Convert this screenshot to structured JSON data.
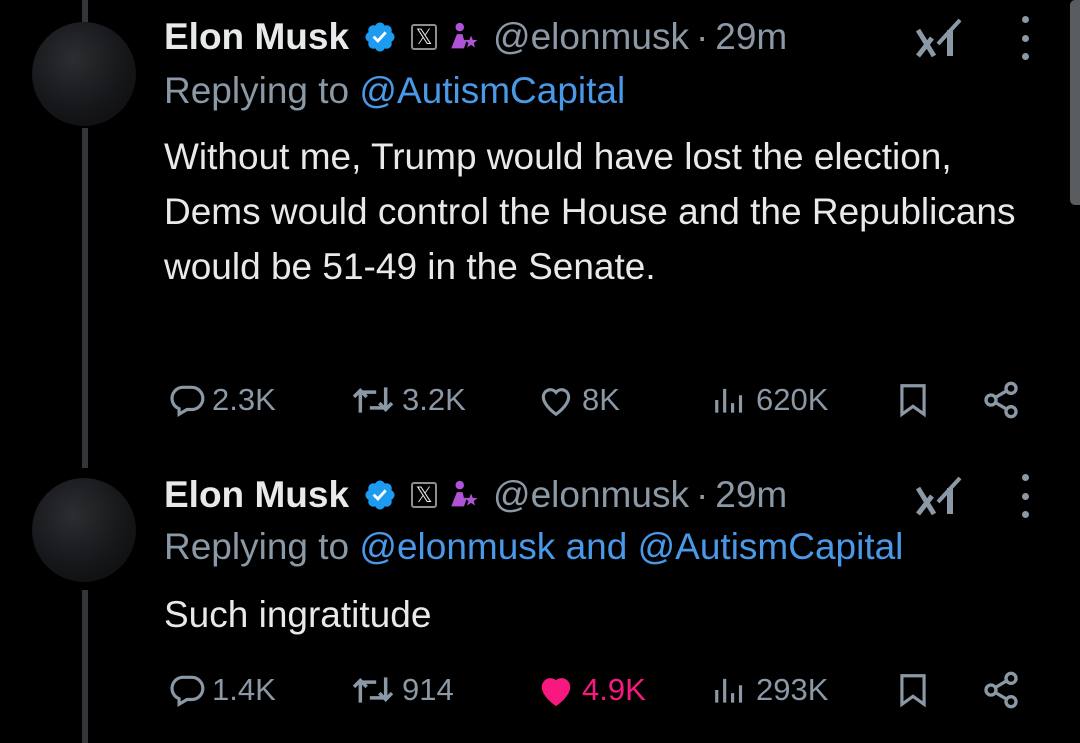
{
  "colors": {
    "background": "#000000",
    "text_primary": "#e7e9ea",
    "text_secondary": "#8b98a5",
    "link": "#4a99e9",
    "like_active": "#f91880",
    "verified": "#1d9bf0"
  },
  "tweets": [
    {
      "author_name": "Elon Musk",
      "affiliation_badge": "𝕏",
      "handle": "@elonmusk",
      "separator": "·",
      "time": "29m",
      "replying_prefix": "Replying to",
      "replying_mentions": "@AutismCapital",
      "text": "Without me, Trump would have lost the election, Dems would control the House and the Republicans would be 51-49 in the Senate.",
      "replies": "2.3K",
      "reposts": "3.2K",
      "likes": "8K",
      "liked": false,
      "views": "620K"
    },
    {
      "author_name": "Elon Musk",
      "affiliation_badge": "𝕏",
      "handle": "@elonmusk",
      "separator": "·",
      "time": "29m",
      "replying_prefix": "Replying to",
      "replying_mentions": "@elonmusk and @AutismCapital",
      "text": "Such ingratitude",
      "replies": "1.4K",
      "reposts": "914",
      "likes": "4.9K",
      "liked": true,
      "views": "293K"
    }
  ],
  "icons": [
    "verified-badge-icon",
    "x-affiliation-icon",
    "government-icon",
    "grok-icon",
    "more-icon",
    "reply-icon",
    "repost-icon",
    "like-icon",
    "views-icon",
    "bookmark-icon",
    "share-icon"
  ]
}
